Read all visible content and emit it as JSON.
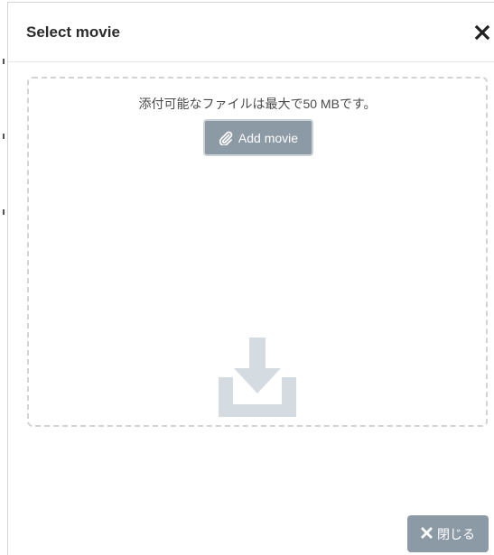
{
  "modal": {
    "title": "Select movie",
    "close_icon": "close-icon"
  },
  "dropzone": {
    "limit_text": "添付可能なファイルは最大で50 MBです。",
    "add_button_label": "Add movie",
    "add_button_icon": "paperclip-icon",
    "drop_icon": "download-icon"
  },
  "footer": {
    "close_button_label": "閉じる",
    "close_button_icon": "close-icon"
  },
  "colors": {
    "button_bg": "#8c9aa6",
    "button_border": "#c9d1d8",
    "dropzone_border": "#d3d3d3",
    "drop_icon": "#d5dce1",
    "title_text": "#2b2b2b"
  }
}
